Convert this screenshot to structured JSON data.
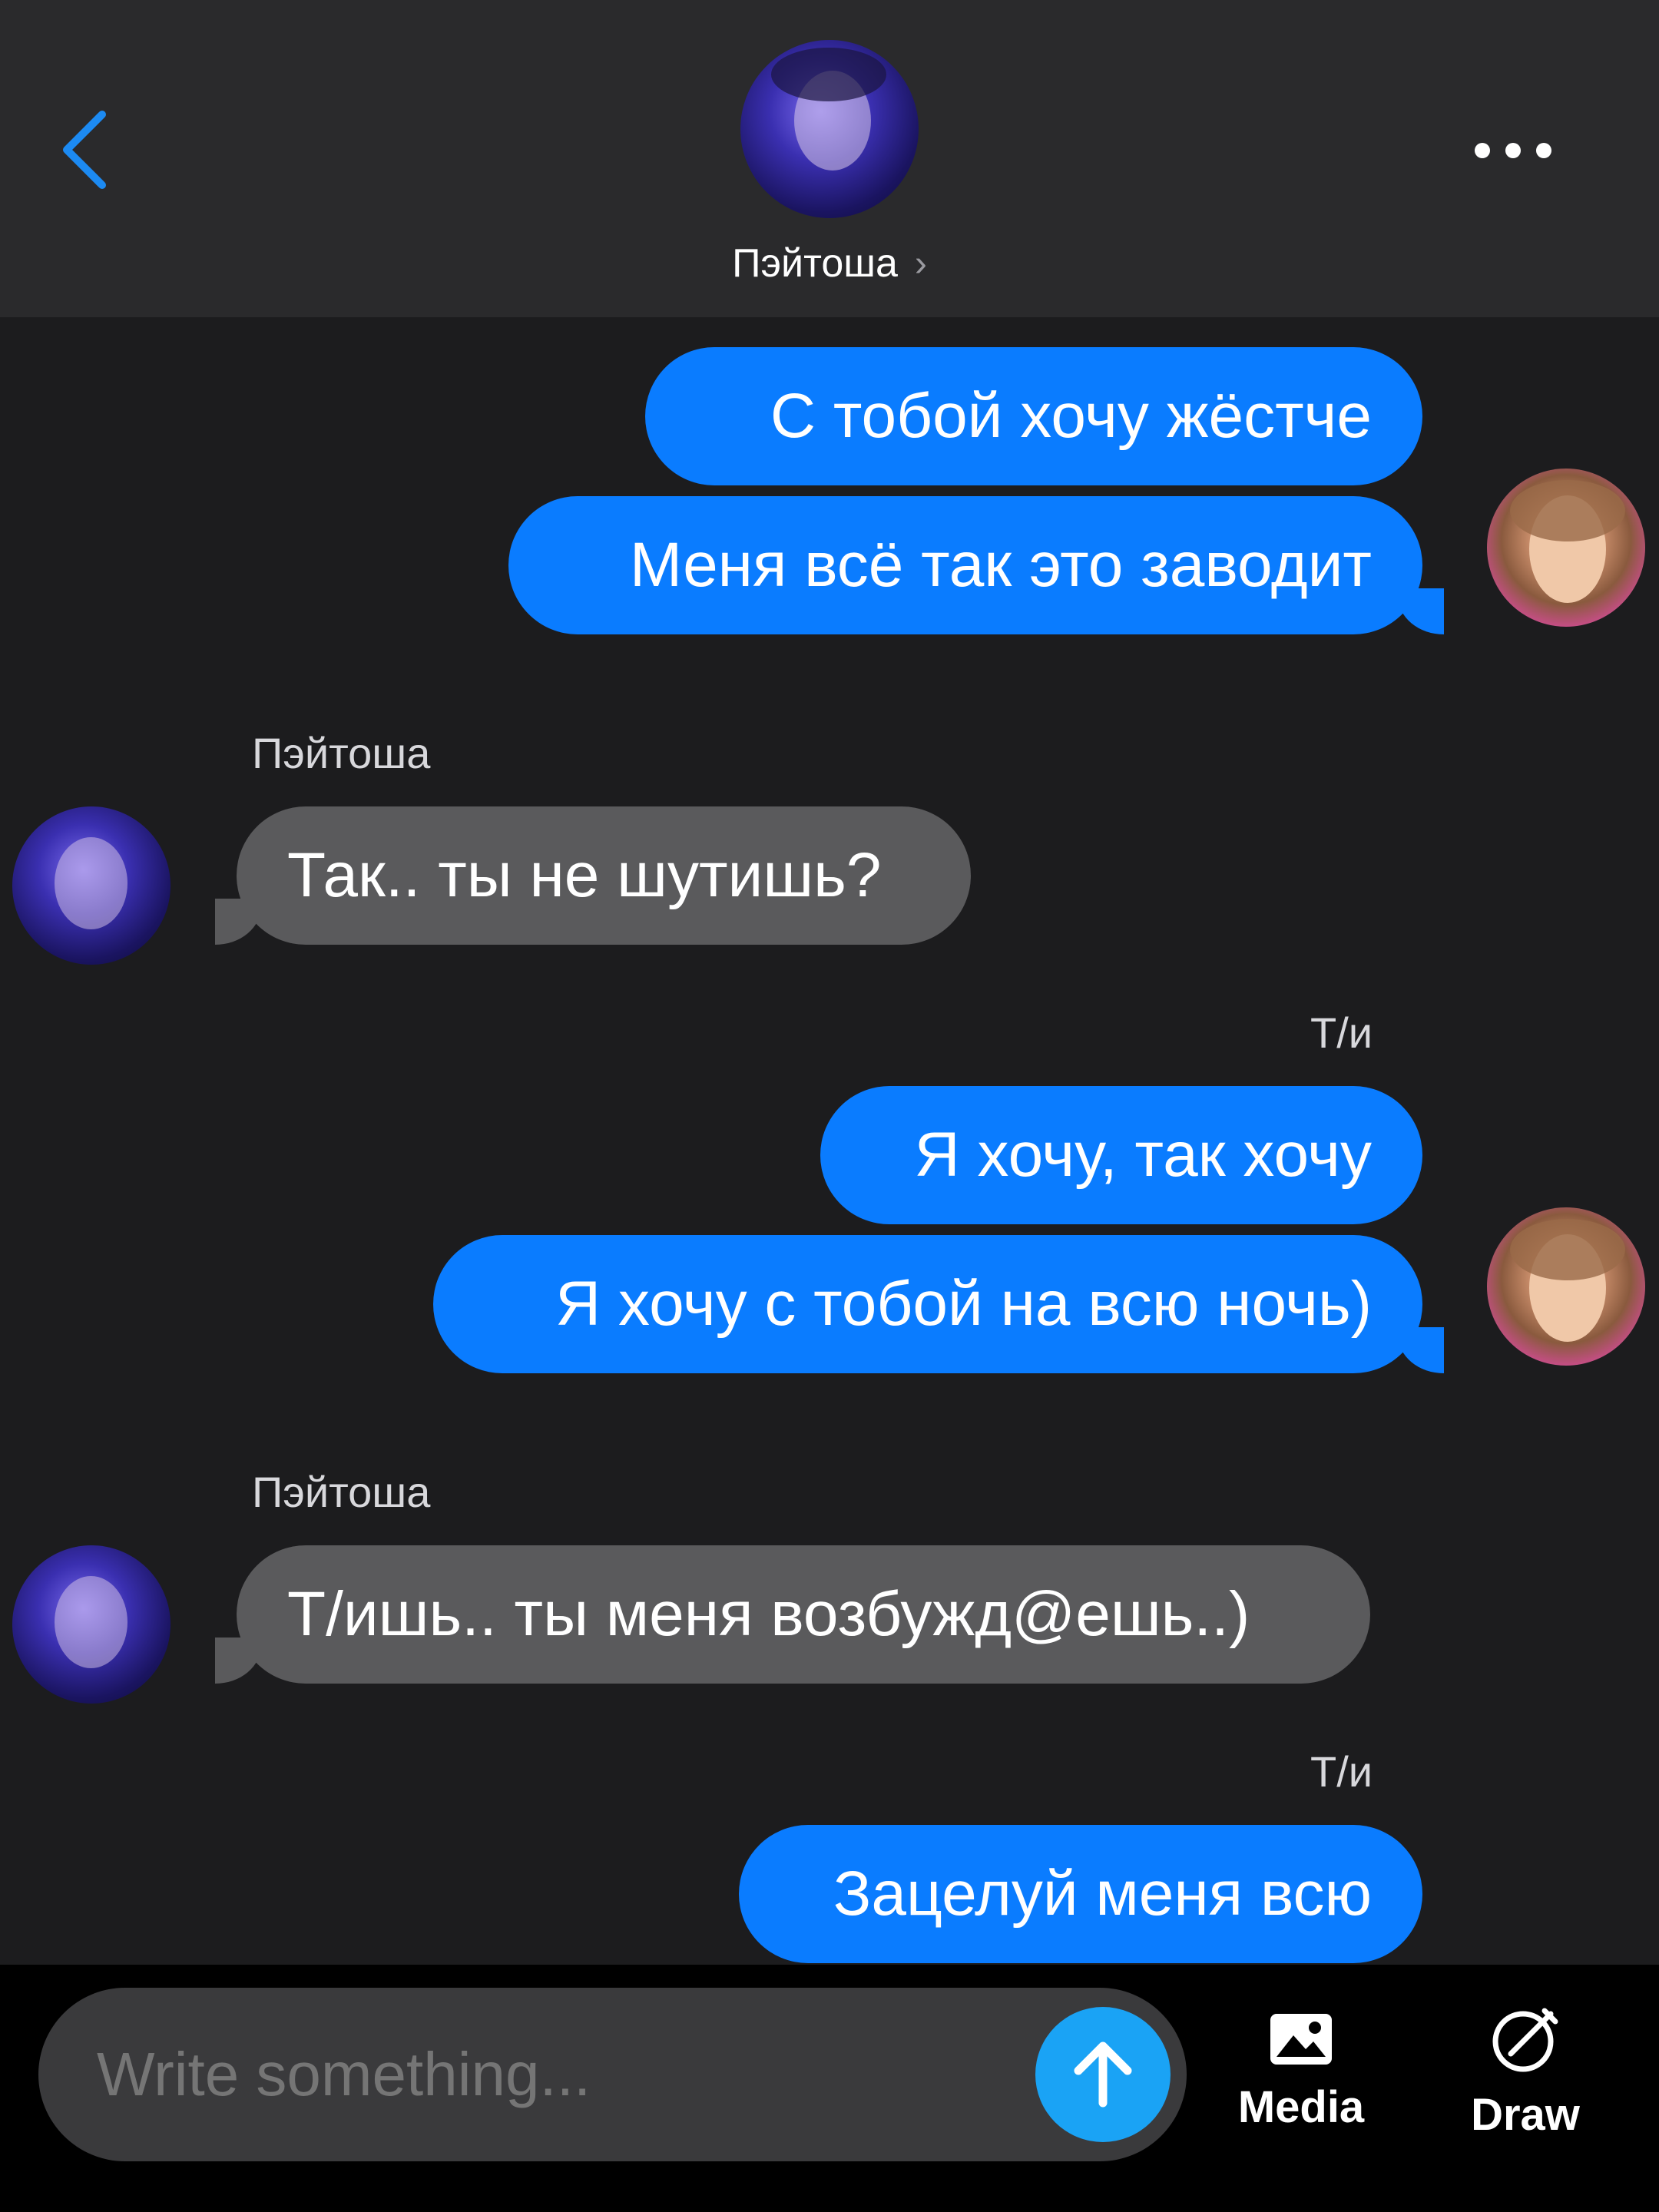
{
  "header": {
    "contact_name": "Пэйтоша"
  },
  "messages": [
    {
      "type": "out",
      "text": "С тобой хочу жёстче"
    },
    {
      "type": "out",
      "text": "Меня всё так это заводит"
    },
    {
      "type": "sender",
      "text": "Пэйтоша"
    },
    {
      "type": "in",
      "text": "Так.. ты не шутишь?"
    },
    {
      "type": "sender",
      "text": "Т/и"
    },
    {
      "type": "out",
      "text": "Я хочу, так хочу"
    },
    {
      "type": "out",
      "text": "Я хочу с тобой на всю ночь)"
    },
    {
      "type": "sender",
      "text": "Пэйтоша"
    },
    {
      "type": "in",
      "text": "Т/ишь.. ты меня возбужд@ешь..)"
    },
    {
      "type": "sender",
      "text": "Т/и"
    },
    {
      "type": "out",
      "text": "Зацелуй меня всю"
    }
  ],
  "composer": {
    "placeholder": "Write something...",
    "media_label": "Media",
    "draw_label": "Draw"
  },
  "colors": {
    "outgoing_bubble": "#0a7cff",
    "incoming_bubble": "#5a5a5c",
    "send_button": "#1aa3f5",
    "background": "#1c1c1e"
  },
  "icons": [
    "back-chevron-icon",
    "more-dots-icon",
    "send-arrow-icon",
    "image-icon",
    "draw-icon"
  ]
}
